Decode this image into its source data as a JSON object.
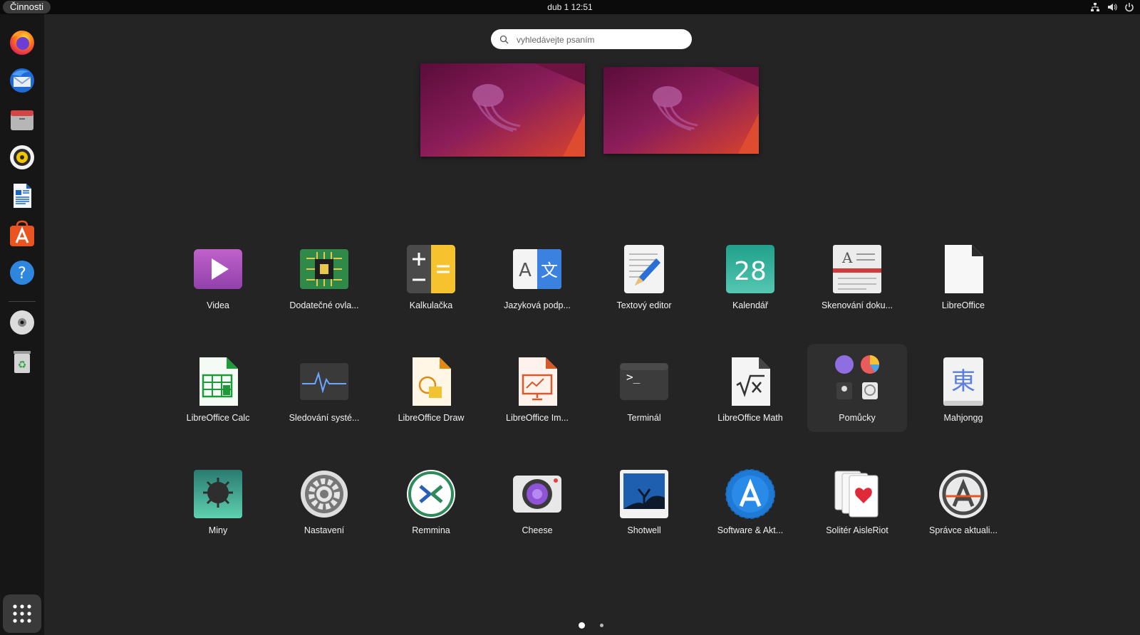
{
  "topbar": {
    "activities": "Činnosti",
    "datetime": "dub 1  12:51",
    "tray_icons": [
      "network-icon",
      "volume-icon",
      "power-icon"
    ]
  },
  "dock": {
    "items": [
      {
        "name": "firefox-icon"
      },
      {
        "name": "thunderbird-icon"
      },
      {
        "name": "files-icon"
      },
      {
        "name": "rhythmbox-icon"
      },
      {
        "name": "libreoffice-writer-icon"
      },
      {
        "name": "app-center-icon"
      },
      {
        "name": "help-icon"
      },
      {
        "name": "optical-disc-icon"
      },
      {
        "name": "trash-icon"
      }
    ],
    "show_apps": "show-apps-grid-icon"
  },
  "search": {
    "placeholder": "vyhledávejte psaním"
  },
  "apps": [
    {
      "label": "Videa"
    },
    {
      "label": "Dodatečné ovla..."
    },
    {
      "label": "Kalkulačka"
    },
    {
      "label": "Jazyková podp..."
    },
    {
      "label": "Textový editor"
    },
    {
      "label": "Kalendář",
      "icon_text": "28"
    },
    {
      "label": "Skenování doku..."
    },
    {
      "label": "LibreOffice"
    },
    {
      "label": "LibreOffice Calc"
    },
    {
      "label": "Sledování systé..."
    },
    {
      "label": "LibreOffice Draw"
    },
    {
      "label": "LibreOffice Im..."
    },
    {
      "label": "Terminál"
    },
    {
      "label": "LibreOffice Math"
    },
    {
      "label": "Pomůcky"
    },
    {
      "label": "Mahjongg",
      "icon_text": "東"
    },
    {
      "label": "Miny"
    },
    {
      "label": "Nastavení"
    },
    {
      "label": "Remmina"
    },
    {
      "label": "Cheese"
    },
    {
      "label": "Shotwell"
    },
    {
      "label": "Software & Akt..."
    },
    {
      "label": "Solitér AisleRiot"
    },
    {
      "label": "Správce aktuali..."
    }
  ],
  "pagination": {
    "pages": 2,
    "current": 1
  },
  "colors": {
    "topbar": "#0b0b0b",
    "background": "#242424",
    "dock": "#161616",
    "accent": "#e95420"
  }
}
